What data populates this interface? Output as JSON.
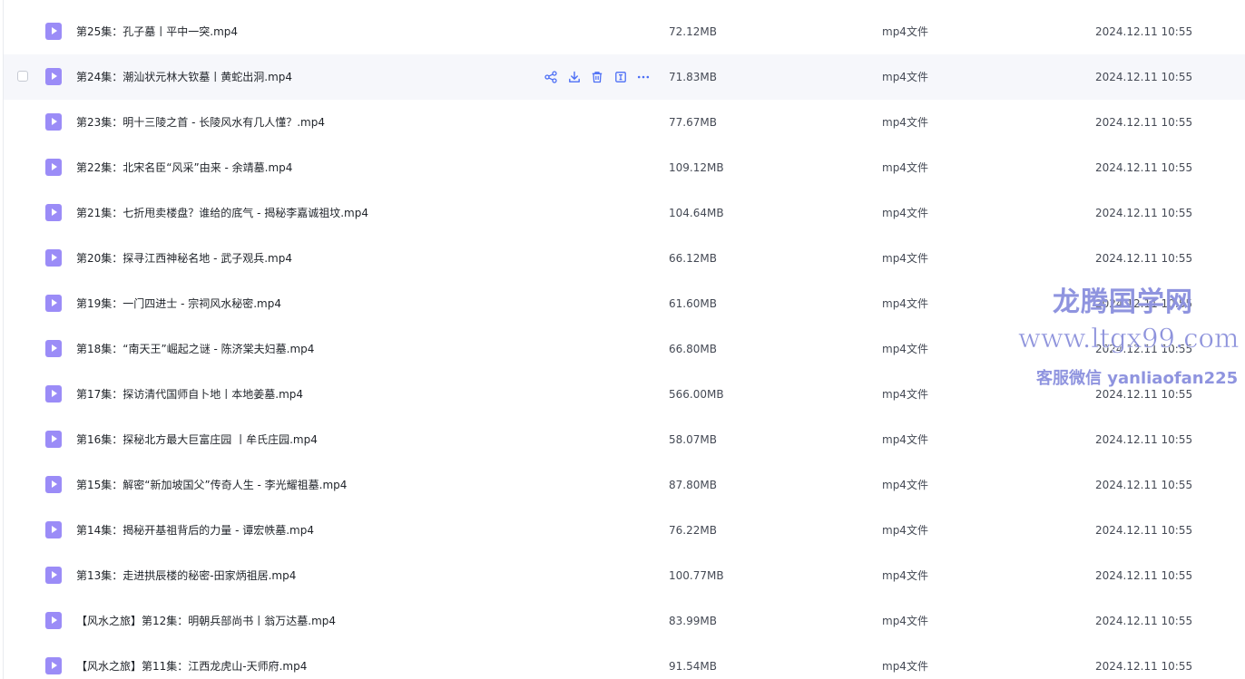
{
  "files": [
    {
      "name": "第25集：孔子墓丨平中一突.mp4",
      "size": "72.12MB",
      "type": "mp4文件",
      "time": "2024.12.11 10:55"
    },
    {
      "name": "第24集：潮汕状元林大钦墓丨黄蛇出洞.mp4",
      "size": "71.83MB",
      "type": "mp4文件",
      "time": "2024.12.11 10:55",
      "hovered": true
    },
    {
      "name": "第23集：明十三陵之首 - 长陵风水有几人懂？.mp4",
      "size": "77.67MB",
      "type": "mp4文件",
      "time": "2024.12.11 10:55"
    },
    {
      "name": "第22集：北宋名臣“风采”由来 - 余靖墓.mp4",
      "size": "109.12MB",
      "type": "mp4文件",
      "time": "2024.12.11 10:55"
    },
    {
      "name": "第21集：七折甩卖楼盘？谁给的底气 - 揭秘李嘉诚祖坟.mp4",
      "size": "104.64MB",
      "type": "mp4文件",
      "time": "2024.12.11 10:55"
    },
    {
      "name": "第20集：探寻江西神秘名地 - 武子观兵.mp4",
      "size": "66.12MB",
      "type": "mp4文件",
      "time": "2024.12.11 10:55"
    },
    {
      "name": "第19集：一门四进士 - 宗祠风水秘密.mp4",
      "size": "61.60MB",
      "type": "mp4文件",
      "time": "2024.12.11 10:55"
    },
    {
      "name": "第18集：“南天王”崛起之谜 - 陈济棠夫妇墓.mp4",
      "size": "66.80MB",
      "type": "mp4文件",
      "time": "2024.12.11 10:55"
    },
    {
      "name": "第17集：探访清代国师自卜地丨本地姜墓.mp4",
      "size": "566.00MB",
      "type": "mp4文件",
      "time": "2024.12.11 10:55"
    },
    {
      "name": "第16集：探秘北方最大巨富庄园 丨牟氏庄园.mp4",
      "size": "58.07MB",
      "type": "mp4文件",
      "time": "2024.12.11 10:55"
    },
    {
      "name": "第15集：解密“新加坡国父”传奇人生 - 李光耀祖墓.mp4",
      "size": "87.80MB",
      "type": "mp4文件",
      "time": "2024.12.11 10:55"
    },
    {
      "name": "第14集：揭秘开基祖背后的力量 - 谭宏帙墓.mp4",
      "size": "76.22MB",
      "type": "mp4文件",
      "time": "2024.12.11 10:55"
    },
    {
      "name": "第13集：走进拱辰楼的秘密-田家炳祖居.mp4",
      "size": "100.77MB",
      "type": "mp4文件",
      "time": "2024.12.11 10:55"
    },
    {
      "name": "【风水之旅】第12集：明朝兵部尚书丨翁万达墓.mp4",
      "size": "83.99MB",
      "type": "mp4文件",
      "time": "2024.12.11 10:55"
    },
    {
      "name": "【风水之旅】第11集：江西龙虎山-天师府.mp4",
      "size": "91.54MB",
      "type": "mp4文件",
      "time": "2024.12.11 10:55"
    }
  ],
  "row_actions": [
    {
      "name": "share-icon"
    },
    {
      "name": "download-icon"
    },
    {
      "name": "delete-icon"
    },
    {
      "name": "rename-icon"
    },
    {
      "name": "more-icon"
    }
  ],
  "colors": {
    "file_icon": "#9b8cf7",
    "action_icon": "#4c6ef5",
    "hover_row": "#f6f7fb",
    "watermark": "#7076d6"
  },
  "watermark": {
    "title": "龙腾国学网",
    "url": "www.ltgx99.com",
    "contact": "客服微信 yanliaofan225"
  }
}
